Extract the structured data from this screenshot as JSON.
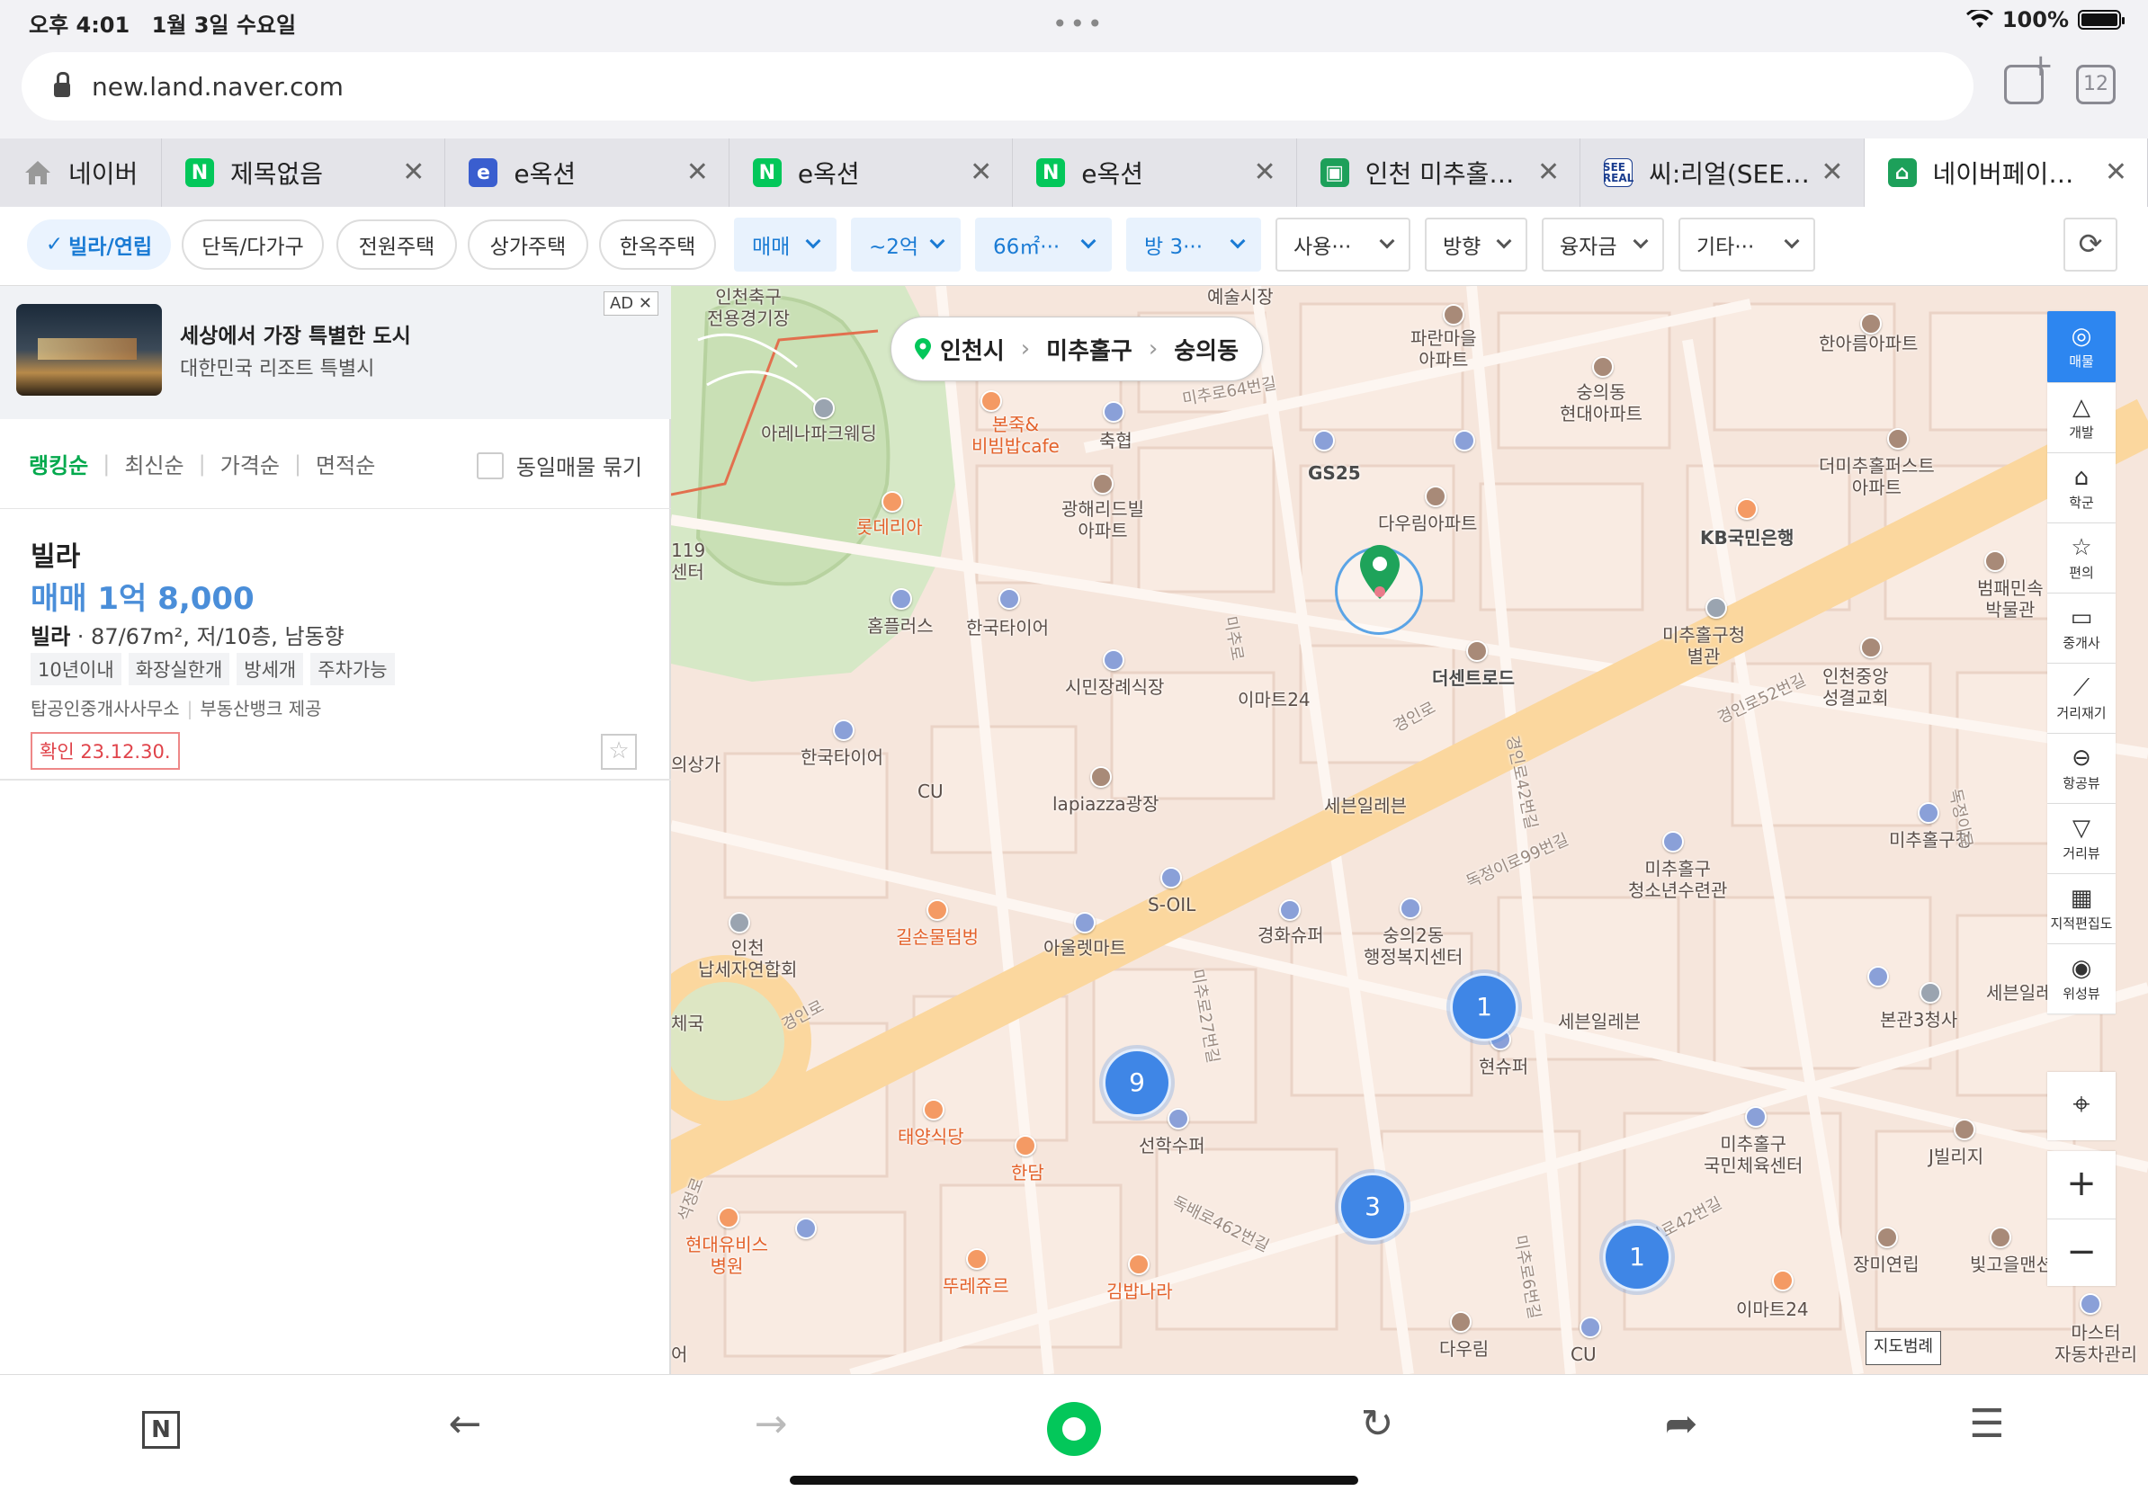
{
  "status": {
    "time": "오후 4:01",
    "date": "1월 3일 수요일",
    "battery": "100%"
  },
  "browser": {
    "url": "new.land.naver.com",
    "tab_count": "12",
    "tabs": [
      {
        "title": "네이버",
        "favicon": "home-icon"
      },
      {
        "title": "제목없음",
        "favicon": "naver-n-icon"
      },
      {
        "title": "e옥션",
        "favicon": "blue-doc-icon"
      },
      {
        "title": "e옥션",
        "favicon": "naver-n-icon"
      },
      {
        "title": "e옥션",
        "favicon": "naver-n-icon"
      },
      {
        "title": "인천 미추홀…",
        "favicon": "map-icon"
      },
      {
        "title": "씨:리얼(SEE…",
        "favicon": "see-real-icon"
      },
      {
        "title": "네이버페이…",
        "favicon": "house-icon"
      }
    ]
  },
  "filters": {
    "chips": [
      "빌라/연립",
      "단독/다가구",
      "전원주택",
      "상가주택",
      "한옥주택"
    ],
    "selected_chip": "빌라/연립",
    "dropdowns": [
      "매매",
      "~2억",
      "66㎡···",
      "방 3···",
      "사용···",
      "방향",
      "융자금",
      "기타···"
    ]
  },
  "ad": {
    "tag": "AD",
    "title": "세상에서 가장 특별한 도시",
    "subtitle": "대한민국 리조트 특별시"
  },
  "sort": {
    "options": [
      "랭킹순",
      "최신순",
      "가격순",
      "면적순"
    ],
    "selected": "랭킹순",
    "group_label": "동일매물 묶기"
  },
  "listing": {
    "type": "빌라",
    "price": "매매 1억 8,000",
    "info_type": "빌라",
    "info_detail": " · 87/67m², 저/10층, 남동향",
    "tags": [
      "10년이내",
      "화장실한개",
      "방세개",
      "주차가능"
    ],
    "agent": "탑공인중개사사무소",
    "provider": "부동산뱅크 제공",
    "confirm": "확인 23.12.30."
  },
  "map": {
    "breadcrumb": [
      "인천시",
      "미추홀구",
      "숭의동"
    ],
    "clusters": [
      {
        "count": "9"
      },
      {
        "count": "1"
      },
      {
        "count": "3"
      },
      {
        "count": "1"
      }
    ],
    "labels": [
      "인천축구\n전용경기장",
      "예술시장",
      "파란마을\n아파트",
      "숭의동\n현대아파트",
      "한아름아파트",
      "아레나파크웨딩",
      "본죽&\n비빔밥cafe",
      "축협",
      "GS25",
      "다우림아파트",
      "더미추홀퍼스트\n아파트",
      "광해리드빌\n아파트",
      "롯데리아",
      "KB국민은행",
      "범패민속\n박물관",
      "홈플러스",
      "한국타이어",
      "시민장례식장",
      "이마트24",
      "더센트로드",
      "미추홀구청\n별관",
      "인천중앙\n성결교회",
      "한국타이어",
      "CU",
      "lapiazza광장",
      "세븐일레븐",
      "미추홀구청",
      "미추홀구\n청소년수련관",
      "S-OIL",
      "경화슈퍼",
      "숭의2동\n행정복지센터",
      "길손물텀벙",
      "아울렛마트",
      "인천\n납세자연합회",
      "세븐일레븐",
      "본관3청사",
      "세븐일레",
      "현슈퍼",
      "태양식당",
      "한담",
      "선학수퍼",
      "미추홀구\n국민체육센터",
      "J빌리지",
      "현대유비스\n병원",
      "뚜레쥬르",
      "김밥나라",
      "장미연립",
      "빛고을맨션",
      "이마트24",
      "마스터\n자동차관리",
      "다우림",
      "CU",
      "의상가",
      "체국",
      "어",
      "119\n센터"
    ],
    "road_labels": [
      "경인로",
      "경인로",
      "미추로64번길",
      "미추로",
      "경인로52번길",
      "경인로42번길",
      "독정이로",
      "독정이로99번길",
      "미추로27번길",
      "독배로462번길",
      "미추로6번길",
      "독정이로42번길",
      "석정로"
    ],
    "legend": "지도범례"
  },
  "toolbar": [
    {
      "label": "매물",
      "icon": "listing-icon"
    },
    {
      "label": "개발",
      "icon": "development-icon"
    },
    {
      "label": "학군",
      "icon": "school-icon"
    },
    {
      "label": "편의",
      "icon": "convenience-icon"
    },
    {
      "label": "중개사",
      "icon": "agent-icon"
    },
    {
      "label": "거리재기",
      "icon": "ruler-icon"
    },
    {
      "label": "항공뷰",
      "icon": "aerial-icon"
    },
    {
      "label": "거리뷰",
      "icon": "street-view-icon"
    },
    {
      "label": "지적편집도",
      "icon": "cadastral-icon"
    },
    {
      "label": "위성뷰",
      "icon": "satellite-icon"
    }
  ],
  "colors": {
    "accent": "#2d86f0",
    "naver_green": "#03c75a",
    "price_blue": "#4a8ed9",
    "map_bg": "#f6e6dc"
  }
}
